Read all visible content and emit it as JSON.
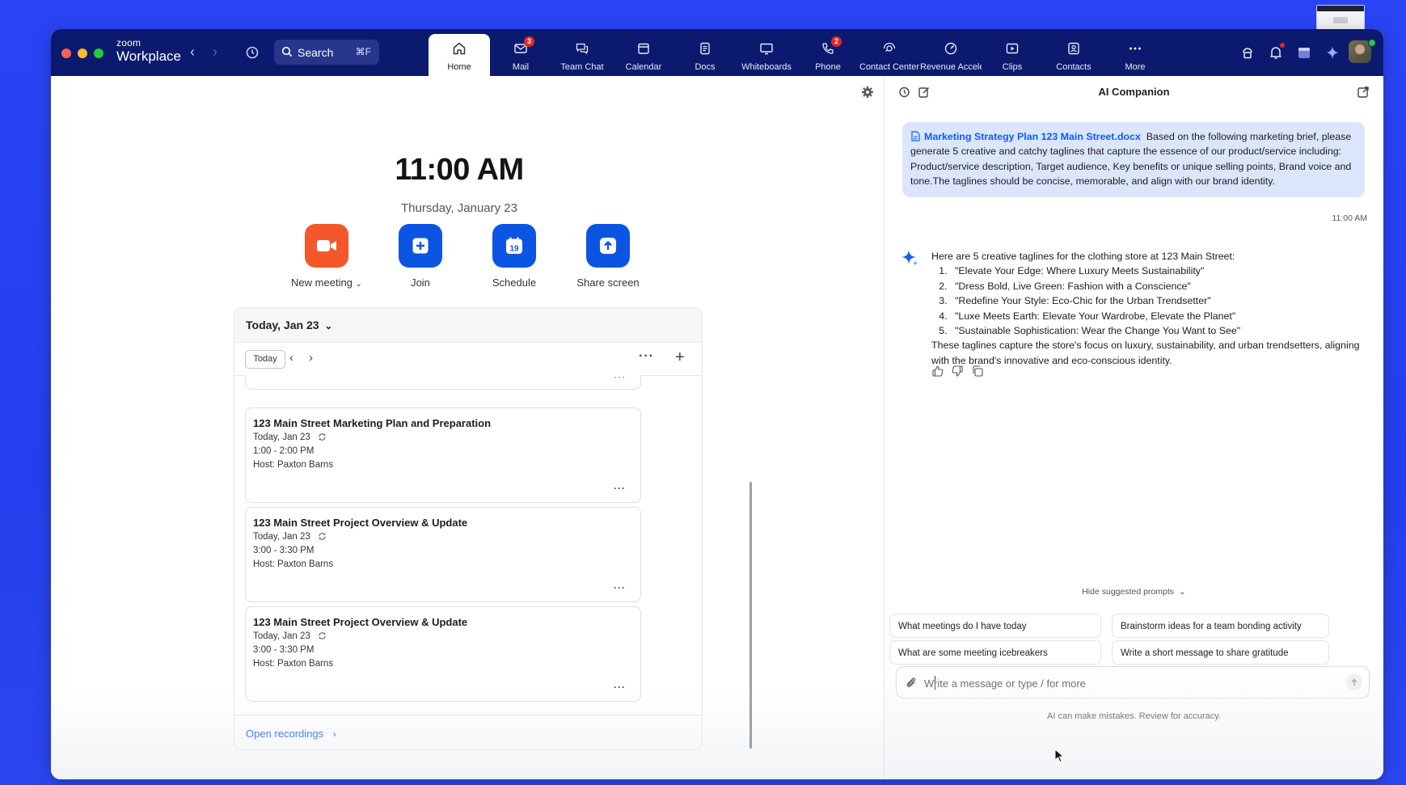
{
  "app": {
    "brand_small": "zoom",
    "brand_name": "Workplace"
  },
  "search": {
    "label": "Search",
    "shortcut": "⌘F"
  },
  "nav_tabs": [
    {
      "label": "Home",
      "icon": "home-icon",
      "active": true
    },
    {
      "label": "Mail",
      "icon": "mail-icon",
      "badge": "3"
    },
    {
      "label": "Team Chat",
      "icon": "chat-icon"
    },
    {
      "label": "Calendar",
      "icon": "calendar-icon"
    },
    {
      "label": "Docs",
      "icon": "docs-icon"
    },
    {
      "label": "Whiteboards",
      "icon": "whiteboard-icon"
    },
    {
      "label": "Phone",
      "icon": "phone-icon",
      "badge": "2"
    },
    {
      "label": "Contact Center",
      "icon": "contact-center-icon"
    },
    {
      "label": "Revenue Acceler",
      "icon": "revenue-icon"
    },
    {
      "label": "Clips",
      "icon": "clips-icon"
    },
    {
      "label": "Contacts",
      "icon": "contacts-icon"
    },
    {
      "label": "More",
      "icon": "more-icon"
    }
  ],
  "home": {
    "time": "11:00 AM",
    "date": "Thursday, January 23",
    "actions": [
      {
        "label": "New meeting",
        "icon": "video-camera-icon",
        "color": "#f4582a"
      },
      {
        "label": "Join",
        "icon": "plus-icon",
        "color": "#0c55e3"
      },
      {
        "label": "Schedule",
        "icon": "calendar-19-icon",
        "color": "#0c55e3",
        "day": "19"
      },
      {
        "label": "Share screen",
        "icon": "share-up-arrow-icon",
        "color": "#0c55e3"
      }
    ]
  },
  "calendar": {
    "heading": "Today, Jan 23",
    "today_button": "Today",
    "meetings": [
      {
        "title": "123 Main Street Marketing Plan and Preparation",
        "date": "Today, Jan 23",
        "time": "1:00 - 2:00 PM",
        "host": "Host: Paxton Barns"
      },
      {
        "title": "123 Main Street Project Overview & Update",
        "date": "Today, Jan 23",
        "time": "3:00 - 3:30 PM",
        "host": "Host: Paxton Barns"
      },
      {
        "title": "123 Main Street Project Overview & Update",
        "date": "Today, Jan 23",
        "time": "3:00 - 3:30 PM",
        "host": "Host: Paxton Barns"
      }
    ],
    "open_recordings": "Open recordings"
  },
  "ai": {
    "title": "AI Companion",
    "user_message": {
      "file_name": "Marketing Strategy Plan 123 Main Street.docx",
      "text": "Based on the following marketing brief, please generate 5 creative and catchy taglines that capture the essence of our product/service including: Product/service description, Target audience, Key benefits or unique selling points, Brand voice and tone.The taglines should be concise, memorable, and align with our brand identity.",
      "time": "11:00 AM"
    },
    "response": {
      "intro": "Here are 5 creative taglines for the clothing store at 123 Main Street:",
      "items": [
        "\"Elevate Your Edge: Where Luxury Meets Sustainability\"",
        "\"Dress Bold, Live Green: Fashion with a Conscience\"",
        "\"Redefine Your Style: Eco-Chic for the Urban Trendsetter\"",
        "\"Luxe Meets Earth: Elevate Your Wardrobe, Elevate the Planet\"",
        "\"Sustainable Sophistication: Wear the Change You Want to See\""
      ],
      "outro": "These taglines capture the store's focus on luxury, sustainability, and urban trendsetters, aligning with the brand's innovative and eco-conscious identity."
    },
    "hide_prompts": "Hide suggested prompts",
    "suggested_prompts": [
      "What meetings do I have today",
      "Brainstorm ideas for a team bonding activity",
      "What are some meeting icebreakers",
      "Write a short message to share gratitude"
    ],
    "composer_placeholder": "Write a message or type / for more",
    "disclaimer": "AI can make mistakes. Review for accuracy."
  },
  "colors": {
    "desktop": "#2440ee",
    "topbar": "#0b1a6e",
    "accent": "#0b5cff",
    "orange": "#f4582a",
    "badge": "#e02828"
  }
}
